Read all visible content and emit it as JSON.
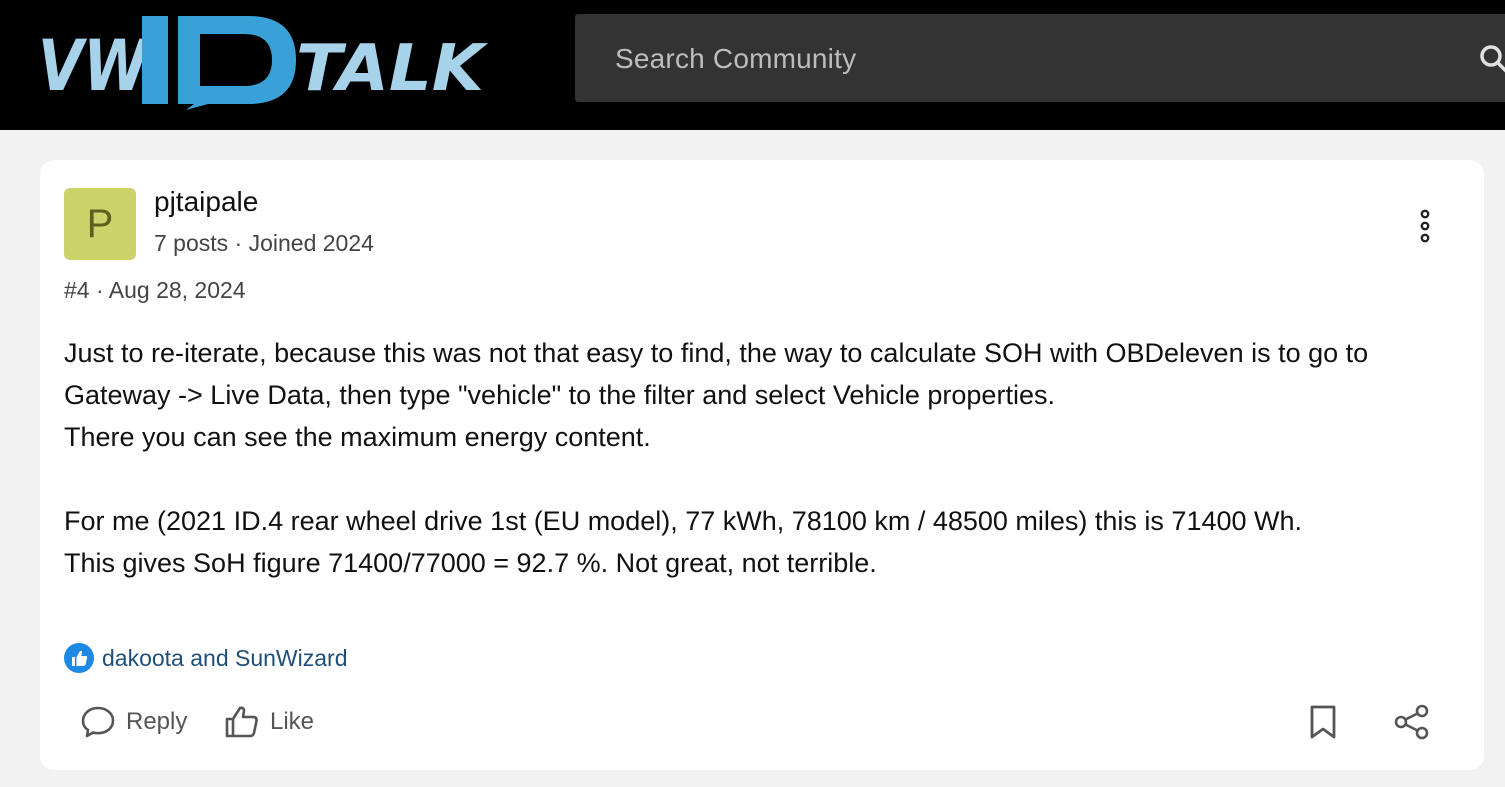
{
  "header": {
    "logo_text": "VW ID TALK",
    "search_placeholder": "Search Community"
  },
  "post": {
    "avatar_letter": "P",
    "username": "pjtaipale",
    "user_meta": "7 posts · Joined 2024",
    "post_meta": "#4 · Aug 28, 2024",
    "body_lines": [
      "Just to re-iterate, because this was not that easy to find, the way to calculate SOH with OBDeleven is to go to",
      "Gateway -> Live Data, then type \"vehicle\" to the filter and select Vehicle properties.",
      "There you can see the maximum energy content.",
      "For me (2021 ID.4 rear wheel drive 1st (EU model), 77 kWh, 78100 km / 48500 miles) this is 71400 Wh.",
      "This gives SoH figure 71400/77000 = 92.7 %. Not great, not terrible."
    ],
    "likes_text": "dakoota and SunWizard",
    "reply_label": "Reply",
    "like_label": "Like"
  },
  "icons": {
    "search": "search-icon",
    "more": "more-vertical-icon",
    "thumbs_up_badge": "thumbs-up-icon",
    "reply": "chat-bubble-icon",
    "like": "thumbs-up-outline-icon",
    "bookmark": "bookmark-icon",
    "share": "share-icon"
  },
  "colors": {
    "header_bg": "#000000",
    "search_bg": "#333333",
    "logo_blue": "#3aa0d8",
    "logo_light": "#a6d2ea",
    "avatar_bg": "#cdd26b",
    "like_badge": "#1e88e5",
    "link": "#1f4e79"
  }
}
